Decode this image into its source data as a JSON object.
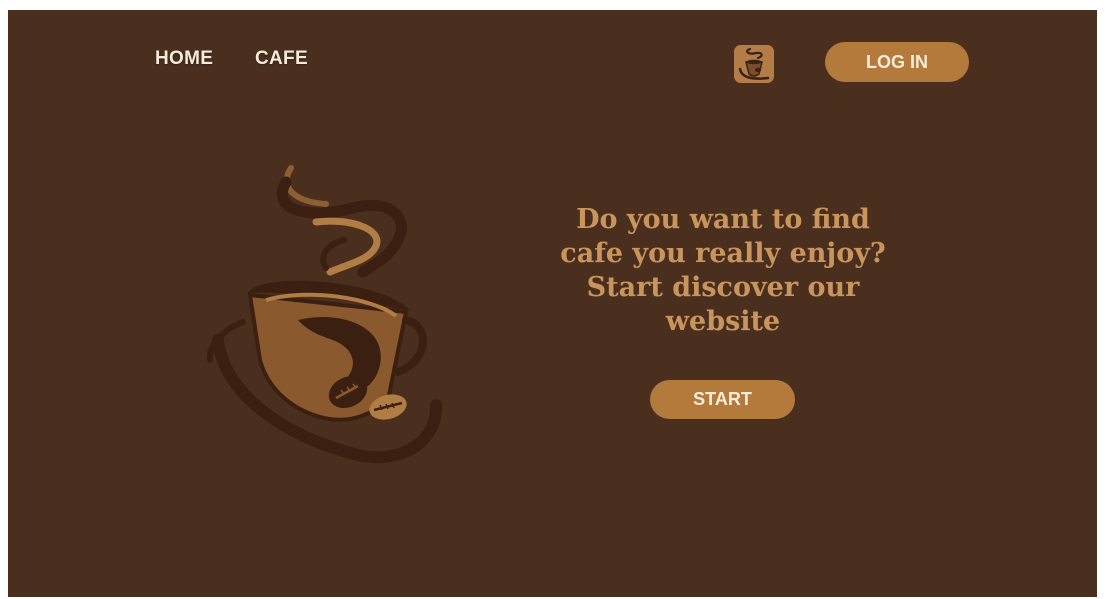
{
  "nav": {
    "home_label": "HOME",
    "cafe_label": "CAFE"
  },
  "header": {
    "logo_icon": "coffee-cup-icon",
    "login_label": "LOG IN"
  },
  "hero": {
    "title": "Do you want to find cafe you really enjoy? Start discover our website",
    "start_label": "START",
    "illustration_icon": "coffee-cup-illustration"
  },
  "colors": {
    "background": "#4a2f1f",
    "accent": "#b47a3c",
    "title_text": "#c9955c",
    "nav_text": "#f6ead8"
  }
}
